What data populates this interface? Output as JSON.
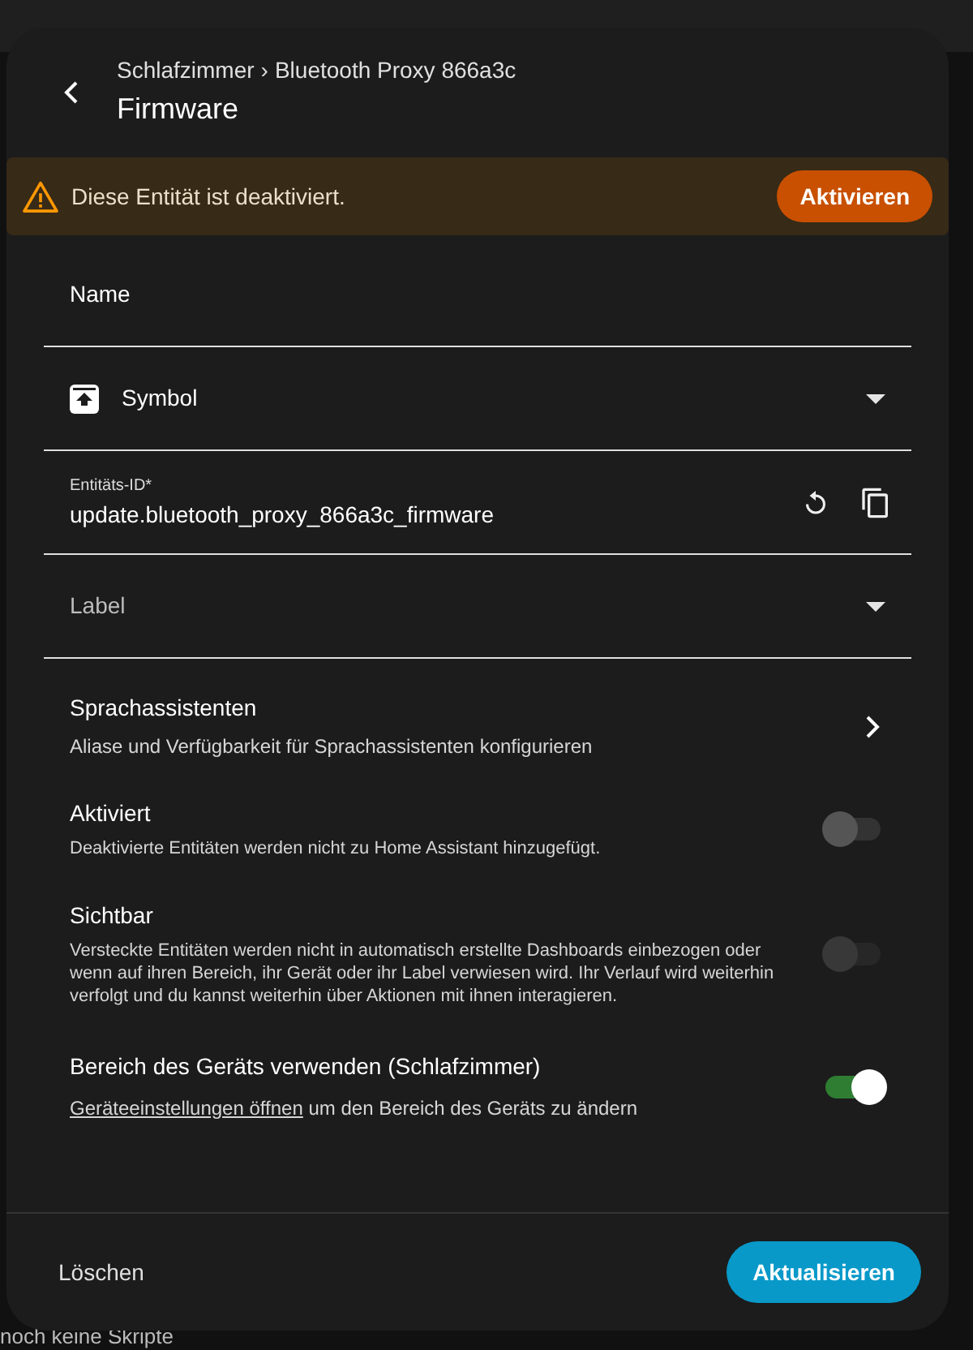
{
  "dialog": {
    "breadcrumb": {
      "area": "Schlafzimmer",
      "separator": "›",
      "device": "Bluetooth Proxy 866a3c"
    },
    "title": "Firmware",
    "alert": {
      "message": "Diese Entität ist deaktiviert.",
      "action": "Aktivieren"
    },
    "fields": [
      {
        "kind": "text",
        "label": "Name"
      },
      {
        "kind": "icon-select",
        "label": "Symbol"
      },
      {
        "kind": "entity-id",
        "label": "Entitäts-ID*",
        "value": "update.bluetooth_proxy_866a3c_firmware"
      },
      {
        "kind": "select",
        "label": "Label"
      }
    ],
    "settings": [
      {
        "kind": "link",
        "title": "Sprachassistenten",
        "description": "Aliase und Verfügbarkeit für Sprachassistenten konfigurieren"
      },
      {
        "kind": "toggle",
        "title": "Aktiviert",
        "description": "Deaktivierte Entitäten werden nicht zu Home Assistant hinzugefügt.",
        "on": false,
        "disabled": false
      },
      {
        "kind": "toggle",
        "title": "Sichtbar",
        "description": "Versteckte Entitäten werden nicht in automatisch erstellte Dashboards einbezogen oder wenn auf ihren Bereich, ihr Gerät oder ihr Label verwiesen wird. Ihr Verlauf wird weiterhin verfolgt und du kannst weiterhin über Aktionen mit ihnen interagieren.",
        "on": false,
        "disabled": true
      },
      {
        "kind": "toggle-link",
        "title": "Bereich des Geräts verwenden (Schlafzimmer)",
        "link": "Geräteeinstellungen öffnen",
        "description": "um den Bereich des Geräts zu ändern",
        "on": true,
        "disabled": false
      }
    ],
    "footer": {
      "delete": "Löschen",
      "update": "Aktualisieren"
    }
  },
  "background": {
    "bottom_text": "noch keine Skripte"
  }
}
